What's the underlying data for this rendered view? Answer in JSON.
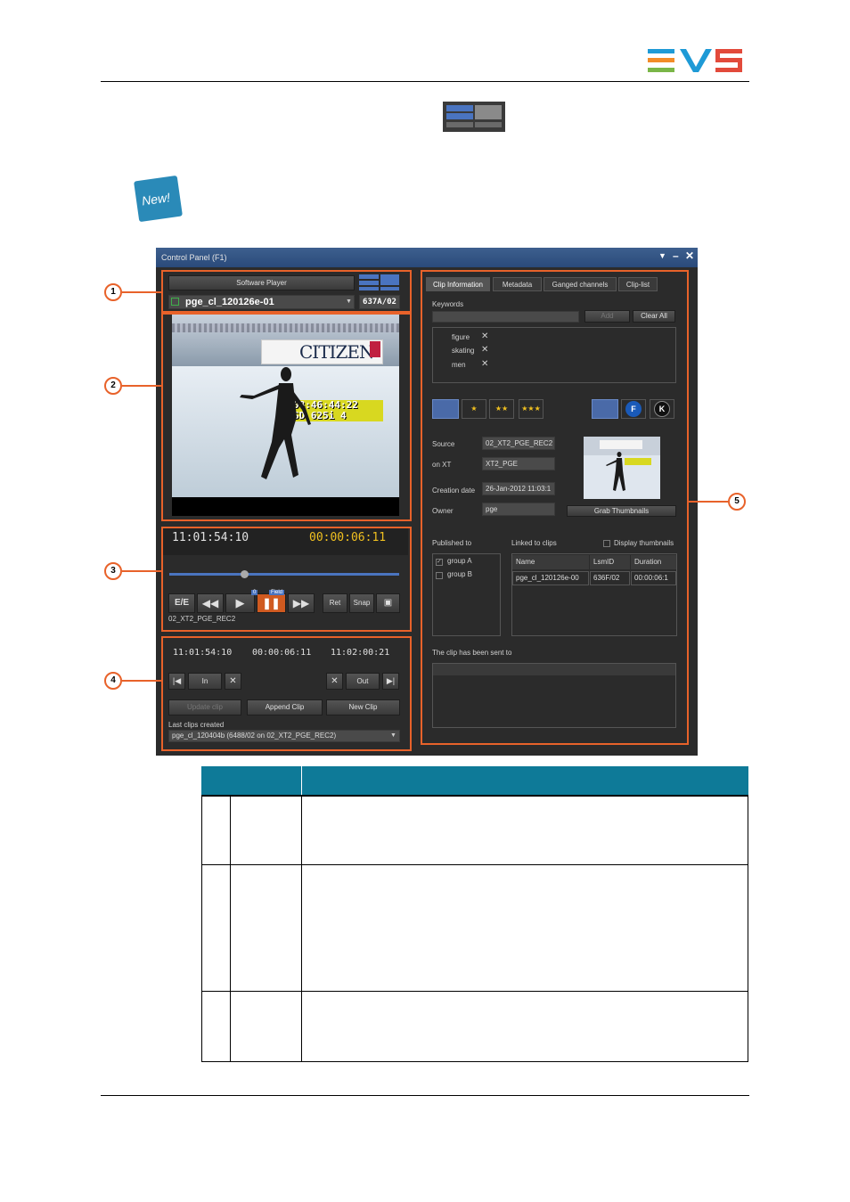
{
  "logo": {
    "text": "EVS",
    "colors": [
      "#1e9ad6",
      "#f28c28",
      "#7ab648",
      "#e24a3b"
    ]
  },
  "new_badge": {
    "label": "New!"
  },
  "panel": {
    "title": "Control Panel (F1)",
    "player": {
      "channel_button": "Software Player",
      "clip_name": "pge_cl_120126e-01",
      "clip_id": "637A/02"
    },
    "video": {
      "ad_text": "CITIZEN",
      "tc_line1": "08:46:44:22",
      "tc_line2": "SD 625i  4"
    },
    "transport": {
      "timecode": "11:01:54:10",
      "duration": "00:00:06:11",
      "ee_label": "E/E",
      "field_label": "Field",
      "field_num": "0",
      "ret_label": "Ret",
      "snap_label": "Snap",
      "source_name": "02_XT2_PGE_REC2"
    },
    "clip_editor": {
      "tc_in": "11:01:54:10",
      "tc_dur": "00:00:06:11",
      "tc_out": "11:02:00:21",
      "in_label": "In",
      "out_label": "Out",
      "update_label": "Update clip",
      "append_label": "Append Clip",
      "new_label": "New Clip",
      "last_clips_label": "Last clips created",
      "last_clip_value": "pge_cl_120404b (6488/02 on 02_XT2_PGE_REC2)"
    },
    "info": {
      "tabs": [
        "Clip Information",
        "Metadata",
        "Ganged channels",
        "Clip-list"
      ],
      "keywords_label": "Keywords",
      "add_label": "Add",
      "clear_label": "Clear All",
      "keywords": [
        "figure",
        "skating",
        "men"
      ],
      "stars": [
        "★",
        "★★",
        "★★★"
      ],
      "f_label": "F",
      "k_label": "K",
      "source_label": "Source",
      "source_value": "02_XT2_PGE_REC2",
      "onxt_label": "on XT",
      "onxt_value": "XT2_PGE",
      "creation_label": "Creation date",
      "creation_value": "26-Jan-2012 11:03:1",
      "owner_label": "Owner",
      "owner_value": "pge",
      "grab_label": "Grab Thumbnails",
      "published_label": "Published to",
      "linked_label": "Linked to clips",
      "display_thumbs_label": "Display thumbnails",
      "groups": [
        "group A",
        "group B"
      ],
      "linked_headers": [
        "Name",
        "LsmID",
        "Duration"
      ],
      "linked_rows": [
        [
          "pge_cl_120126e-00",
          "636F/02",
          "00:00:06:1"
        ]
      ],
      "sent_label": "The clip has been sent to"
    }
  },
  "callouts": [
    "1",
    "2",
    "3",
    "4",
    "5"
  ]
}
